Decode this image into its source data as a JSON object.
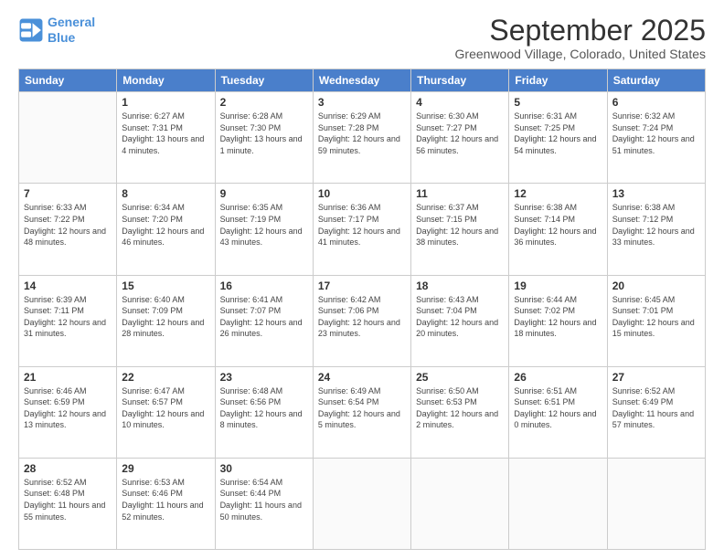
{
  "logo": {
    "line1": "General",
    "line2": "Blue"
  },
  "title": "September 2025",
  "subtitle": "Greenwood Village, Colorado, United States",
  "days_of_week": [
    "Sunday",
    "Monday",
    "Tuesday",
    "Wednesday",
    "Thursday",
    "Friday",
    "Saturday"
  ],
  "weeks": [
    [
      {
        "day": "",
        "sunrise": "",
        "sunset": "",
        "daylight": ""
      },
      {
        "day": "1",
        "sunrise": "Sunrise: 6:27 AM",
        "sunset": "Sunset: 7:31 PM",
        "daylight": "Daylight: 13 hours and 4 minutes."
      },
      {
        "day": "2",
        "sunrise": "Sunrise: 6:28 AM",
        "sunset": "Sunset: 7:30 PM",
        "daylight": "Daylight: 13 hours and 1 minute."
      },
      {
        "day": "3",
        "sunrise": "Sunrise: 6:29 AM",
        "sunset": "Sunset: 7:28 PM",
        "daylight": "Daylight: 12 hours and 59 minutes."
      },
      {
        "day": "4",
        "sunrise": "Sunrise: 6:30 AM",
        "sunset": "Sunset: 7:27 PM",
        "daylight": "Daylight: 12 hours and 56 minutes."
      },
      {
        "day": "5",
        "sunrise": "Sunrise: 6:31 AM",
        "sunset": "Sunset: 7:25 PM",
        "daylight": "Daylight: 12 hours and 54 minutes."
      },
      {
        "day": "6",
        "sunrise": "Sunrise: 6:32 AM",
        "sunset": "Sunset: 7:24 PM",
        "daylight": "Daylight: 12 hours and 51 minutes."
      }
    ],
    [
      {
        "day": "7",
        "sunrise": "Sunrise: 6:33 AM",
        "sunset": "Sunset: 7:22 PM",
        "daylight": "Daylight: 12 hours and 48 minutes."
      },
      {
        "day": "8",
        "sunrise": "Sunrise: 6:34 AM",
        "sunset": "Sunset: 7:20 PM",
        "daylight": "Daylight: 12 hours and 46 minutes."
      },
      {
        "day": "9",
        "sunrise": "Sunrise: 6:35 AM",
        "sunset": "Sunset: 7:19 PM",
        "daylight": "Daylight: 12 hours and 43 minutes."
      },
      {
        "day": "10",
        "sunrise": "Sunrise: 6:36 AM",
        "sunset": "Sunset: 7:17 PM",
        "daylight": "Daylight: 12 hours and 41 minutes."
      },
      {
        "day": "11",
        "sunrise": "Sunrise: 6:37 AM",
        "sunset": "Sunset: 7:15 PM",
        "daylight": "Daylight: 12 hours and 38 minutes."
      },
      {
        "day": "12",
        "sunrise": "Sunrise: 6:38 AM",
        "sunset": "Sunset: 7:14 PM",
        "daylight": "Daylight: 12 hours and 36 minutes."
      },
      {
        "day": "13",
        "sunrise": "Sunrise: 6:38 AM",
        "sunset": "Sunset: 7:12 PM",
        "daylight": "Daylight: 12 hours and 33 minutes."
      }
    ],
    [
      {
        "day": "14",
        "sunrise": "Sunrise: 6:39 AM",
        "sunset": "Sunset: 7:11 PM",
        "daylight": "Daylight: 12 hours and 31 minutes."
      },
      {
        "day": "15",
        "sunrise": "Sunrise: 6:40 AM",
        "sunset": "Sunset: 7:09 PM",
        "daylight": "Daylight: 12 hours and 28 minutes."
      },
      {
        "day": "16",
        "sunrise": "Sunrise: 6:41 AM",
        "sunset": "Sunset: 7:07 PM",
        "daylight": "Daylight: 12 hours and 26 minutes."
      },
      {
        "day": "17",
        "sunrise": "Sunrise: 6:42 AM",
        "sunset": "Sunset: 7:06 PM",
        "daylight": "Daylight: 12 hours and 23 minutes."
      },
      {
        "day": "18",
        "sunrise": "Sunrise: 6:43 AM",
        "sunset": "Sunset: 7:04 PM",
        "daylight": "Daylight: 12 hours and 20 minutes."
      },
      {
        "day": "19",
        "sunrise": "Sunrise: 6:44 AM",
        "sunset": "Sunset: 7:02 PM",
        "daylight": "Daylight: 12 hours and 18 minutes."
      },
      {
        "day": "20",
        "sunrise": "Sunrise: 6:45 AM",
        "sunset": "Sunset: 7:01 PM",
        "daylight": "Daylight: 12 hours and 15 minutes."
      }
    ],
    [
      {
        "day": "21",
        "sunrise": "Sunrise: 6:46 AM",
        "sunset": "Sunset: 6:59 PM",
        "daylight": "Daylight: 12 hours and 13 minutes."
      },
      {
        "day": "22",
        "sunrise": "Sunrise: 6:47 AM",
        "sunset": "Sunset: 6:57 PM",
        "daylight": "Daylight: 12 hours and 10 minutes."
      },
      {
        "day": "23",
        "sunrise": "Sunrise: 6:48 AM",
        "sunset": "Sunset: 6:56 PM",
        "daylight": "Daylight: 12 hours and 8 minutes."
      },
      {
        "day": "24",
        "sunrise": "Sunrise: 6:49 AM",
        "sunset": "Sunset: 6:54 PM",
        "daylight": "Daylight: 12 hours and 5 minutes."
      },
      {
        "day": "25",
        "sunrise": "Sunrise: 6:50 AM",
        "sunset": "Sunset: 6:53 PM",
        "daylight": "Daylight: 12 hours and 2 minutes."
      },
      {
        "day": "26",
        "sunrise": "Sunrise: 6:51 AM",
        "sunset": "Sunset: 6:51 PM",
        "daylight": "Daylight: 12 hours and 0 minutes."
      },
      {
        "day": "27",
        "sunrise": "Sunrise: 6:52 AM",
        "sunset": "Sunset: 6:49 PM",
        "daylight": "Daylight: 11 hours and 57 minutes."
      }
    ],
    [
      {
        "day": "28",
        "sunrise": "Sunrise: 6:52 AM",
        "sunset": "Sunset: 6:48 PM",
        "daylight": "Daylight: 11 hours and 55 minutes."
      },
      {
        "day": "29",
        "sunrise": "Sunrise: 6:53 AM",
        "sunset": "Sunset: 6:46 PM",
        "daylight": "Daylight: 11 hours and 52 minutes."
      },
      {
        "day": "30",
        "sunrise": "Sunrise: 6:54 AM",
        "sunset": "Sunset: 6:44 PM",
        "daylight": "Daylight: 11 hours and 50 minutes."
      },
      {
        "day": "",
        "sunrise": "",
        "sunset": "",
        "daylight": ""
      },
      {
        "day": "",
        "sunrise": "",
        "sunset": "",
        "daylight": ""
      },
      {
        "day": "",
        "sunrise": "",
        "sunset": "",
        "daylight": ""
      },
      {
        "day": "",
        "sunrise": "",
        "sunset": "",
        "daylight": ""
      }
    ]
  ]
}
